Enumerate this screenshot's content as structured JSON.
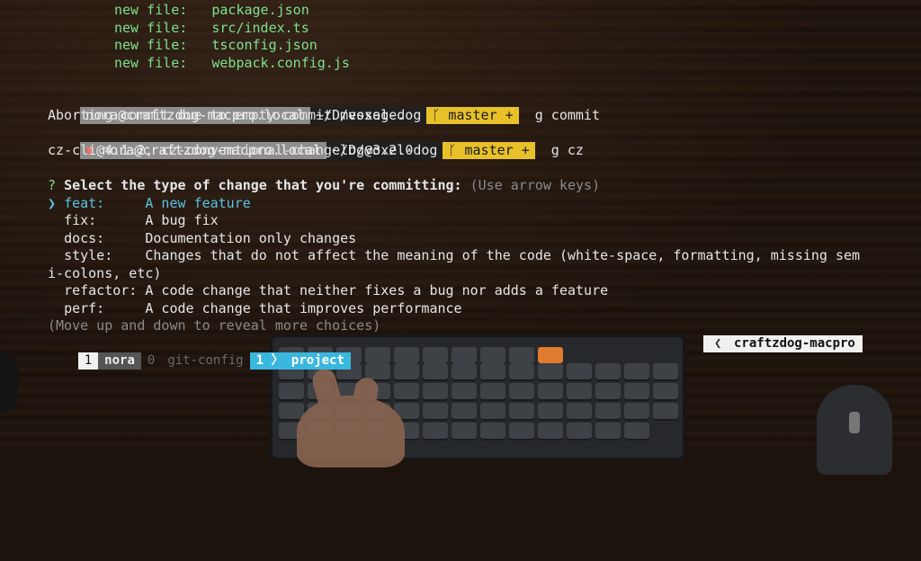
{
  "new_files": [
    {
      "label": "new file:",
      "name": "package.json"
    },
    {
      "label": "new file:",
      "name": "src/index.ts"
    },
    {
      "label": "new file:",
      "name": "tsconfig.json"
    },
    {
      "label": "new file:",
      "name": "webpack.config.js"
    }
  ],
  "prompt1": {
    "user": "nora@craftzdog-macpro.local",
    "path": "~/D/voxel-dog",
    "branch_icon": "ᚴ",
    "branch": "master +",
    "command": "g commit"
  },
  "abort_message": "Aborting commit due to empty commit message.",
  "prompt2": {
    "error_mark": "✘",
    "user": "nora@craftzdog-macpro.local",
    "path": "~/D/voxel-dog",
    "branch_icon": "ᚴ",
    "branch": "master +",
    "command": "g cz"
  },
  "cz_version": "cz-cli@4.1.2, cz-conventional-changelog@3.2.0",
  "question": {
    "mark": "?",
    "text": "Select the type of change that you're committing:",
    "hint": "(Use arrow keys)"
  },
  "choices": [
    {
      "selected": true,
      "pointer": "❯",
      "key": "feat:",
      "desc": "A new feature"
    },
    {
      "selected": false,
      "key": "fix:",
      "desc": "A bug fix"
    },
    {
      "selected": false,
      "key": "docs:",
      "desc": "Documentation only changes"
    },
    {
      "selected": false,
      "key": "style:",
      "desc": "Changes that do not affect the meaning of the code (white-space, formatting, missing sem",
      "desc_cont": "i-colons, etc)"
    },
    {
      "selected": false,
      "key": "refactor:",
      "desc": "A code change that neither fixes a bug nor adds a feature"
    },
    {
      "selected": false,
      "key": "perf:",
      "desc": "A code change that improves performance"
    }
  ],
  "more_hint": "(Move up and down to reveal more choices)",
  "statusbar": {
    "session_num": "1",
    "session_name": "nora",
    "win0_idx": "0",
    "win0_name": "git-config",
    "win1_idx": "1",
    "win1_name": "project",
    "host": "craftzdog-macpro",
    "host_chevron": "❮"
  },
  "colors": {
    "git_segment": "#e8c12a",
    "active_window": "#3ab7df",
    "new_file_green": "#7ee08a"
  }
}
